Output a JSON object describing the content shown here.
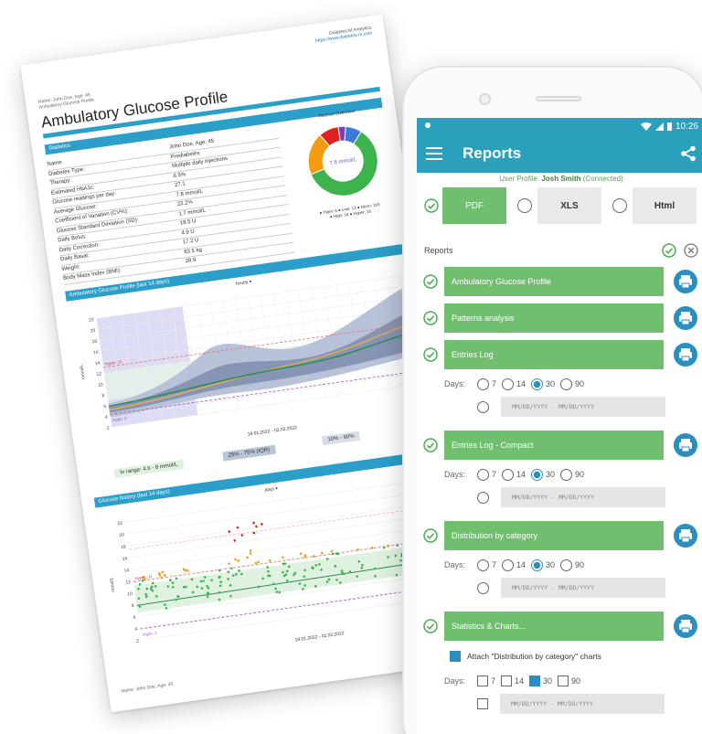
{
  "paper": {
    "brand": "Diabetes:M Analytics",
    "brand_url": "https://www.diabetes-m.com",
    "patient_top": "Name: John Doe, Age: 45",
    "patient_top2": "Ambulatory Glucose Profile",
    "title": "Ambulatory Glucose Profile",
    "statistics_header": "Statistics",
    "stats": [
      {
        "k": "Name:",
        "v": "John Doe, Age: 45"
      },
      {
        "k": "Diabetes Type:",
        "v": "Prediabetes"
      },
      {
        "k": "Therapy:",
        "v": "Multiple daily injections"
      },
      {
        "k": "Estimated HbA1c:",
        "v": "6.5%"
      },
      {
        "k": "Glucose readings per day:",
        "v": "27.1"
      },
      {
        "k": "Average Glucose:",
        "v": "7.8 mmol/L"
      },
      {
        "k": "Coefficient of Variation (CV%):",
        "v": "22.2%"
      },
      {
        "k": "Glucose Standard Deviation (SD):",
        "v": "1.7 mmol/L"
      },
      {
        "k": "Daily Bolus:",
        "v": "18.5 U"
      },
      {
        "k": "Daily Correction:",
        "v": "4.9 U"
      },
      {
        "k": "Daily Basal:",
        "v": "17.2 U"
      },
      {
        "k": "Weight:",
        "v": "83.5 kg"
      },
      {
        "k": "Body Mass Index (BMI):",
        "v": "28.9"
      }
    ],
    "overview_title": "Glucose Overview",
    "donut_center": "7.8 mmol/L",
    "donut_slices": [
      {
        "name": "Hypo",
        "value": 6,
        "color": "#7b3fb8"
      },
      {
        "name": "Low",
        "value": 13,
        "color": "#3a7bd5"
      },
      {
        "name": "Norm",
        "value": 103,
        "color": "#3cb44b"
      },
      {
        "name": "High",
        "value": 34,
        "color": "#f39c12"
      },
      {
        "name": "Hyper",
        "value": 16,
        "color": "#e02020"
      }
    ],
    "legend_line1": "● Hypo: 6  ● Low: 13  ● Norm: 103",
    "legend_line2": "● High: 34  ● Hyper: 16",
    "agp_header": "Ambulatory Glucose Profile (last 14 days)",
    "agp_dropdown": "hourly ▾",
    "agp_y_label": "mmol/L",
    "agp_date_range": "19.01.2022 - 02.02.2022",
    "range_in": "In range: 4.6 - 8 mmol/L",
    "range_iqr": "25% - 75% (IQR)",
    "range_90": "10% - 90%",
    "history_header": "Glucose history (last 14 days)",
    "history_dropdown": "days ▾",
    "history_date_range": "19.01.2022 - 02.02.2022",
    "footer": "Name: John Doe, Age: 45",
    "y_ticks": [
      "22",
      "20",
      "18",
      "16",
      "14",
      "12",
      "10",
      "8",
      "6",
      "4",
      "2"
    ],
    "hyper_label": "Hyper: 11",
    "hypo_label": "Hypo: 3",
    "colors": {
      "accent": "#2b9fc9"
    }
  },
  "status": {
    "time": "10:26"
  },
  "app": {
    "title": "Reports",
    "user_profile_prefix": "User Profile: ",
    "user_name": "Josh Smith",
    "user_status": " (Connected)",
    "formats": {
      "pdf": "PDF",
      "xls": "XLS",
      "html": "Html"
    },
    "reports_label": "Reports",
    "items": [
      {
        "label": "Ambulatory Glucose Profile"
      },
      {
        "label": "Patterns analysis"
      },
      {
        "label": "Entries Log"
      },
      {
        "label": "Entries Log - Compact"
      },
      {
        "label": "Distribution by category"
      },
      {
        "label": "Statistics & Charts..."
      }
    ],
    "days_label": "Days:",
    "day_options": [
      "7",
      "14",
      "30",
      "90"
    ],
    "selected_days": "30",
    "date_placeholder": "MM/DD/YYYY - MM/DD/YYYY",
    "attach_label": "Attach \"Distribution by category\" charts",
    "colors": {
      "primary": "#2aa0bd",
      "green": "#6fbf6f",
      "print": "#2a8fc0",
      "check": "#4caf50"
    }
  }
}
